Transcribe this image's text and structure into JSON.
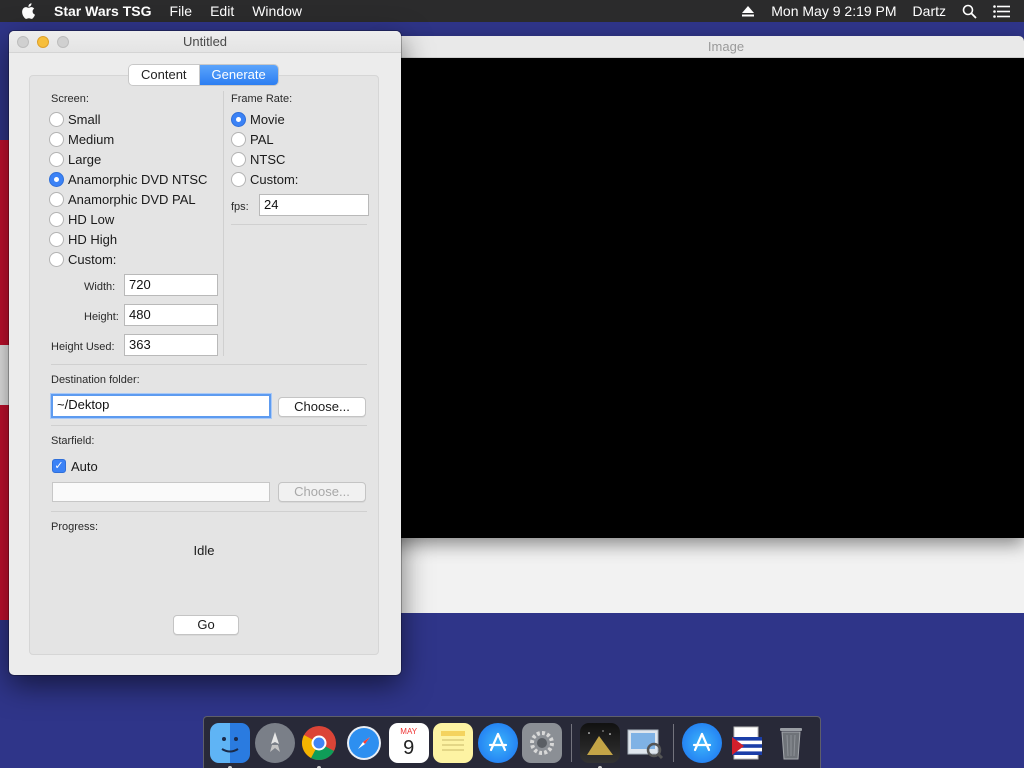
{
  "menubar": {
    "app_name": "Star Wars TSG",
    "menus": [
      "File",
      "Edit",
      "Window"
    ],
    "datetime": "Mon May 9  2:19 PM",
    "user": "Dartz"
  },
  "image_window": {
    "title": "Image"
  },
  "main_window": {
    "title": "Untitled",
    "tabs": [
      "Content",
      "Generate"
    ],
    "active_tab": "Generate",
    "screen": {
      "label": "Screen:",
      "options": [
        "Small",
        "Medium",
        "Large",
        "Anamorphic DVD NTSC",
        "Anamorphic DVD PAL",
        "HD Low",
        "HD High",
        "Custom:"
      ],
      "selected": "Anamorphic DVD NTSC",
      "width_label": "Width:",
      "width_value": "720",
      "height_label": "Height:",
      "height_value": "480",
      "height_used_label": "Height Used:",
      "height_used_value": "363"
    },
    "frame_rate": {
      "label": "Frame Rate:",
      "options": [
        "Movie",
        "PAL",
        "NTSC",
        "Custom:"
      ],
      "selected": "Movie",
      "fps_label": "fps:",
      "fps_value": "24"
    },
    "destination": {
      "label": "Destination folder:",
      "value": "~/Dektop",
      "choose_label": "Choose..."
    },
    "starfield": {
      "label": "Starfield:",
      "auto_label": "Auto",
      "auto_checked": true,
      "path_value": "",
      "choose_label": "Choose..."
    },
    "progress": {
      "label": "Progress:",
      "status": "Idle"
    },
    "go_label": "Go"
  },
  "dock": {
    "calendar_month": "MAY",
    "calendar_day": "9",
    "apps": [
      "finder-icon",
      "launchpad-icon",
      "chrome-icon",
      "safari-icon",
      "calendar-icon",
      "notes-icon",
      "app-store-icon",
      "system-preferences-icon",
      "star-wars-tsg-icon",
      "preview-icon",
      "app-store-installer-icon",
      "flag-document-icon",
      "trash-icon"
    ]
  },
  "colors": {
    "accent": "#3b82f6",
    "menubar_bg": "#2b2b2c",
    "wallpaper_blue": "#2f3589",
    "wallpaper_red": "#c8102e"
  }
}
